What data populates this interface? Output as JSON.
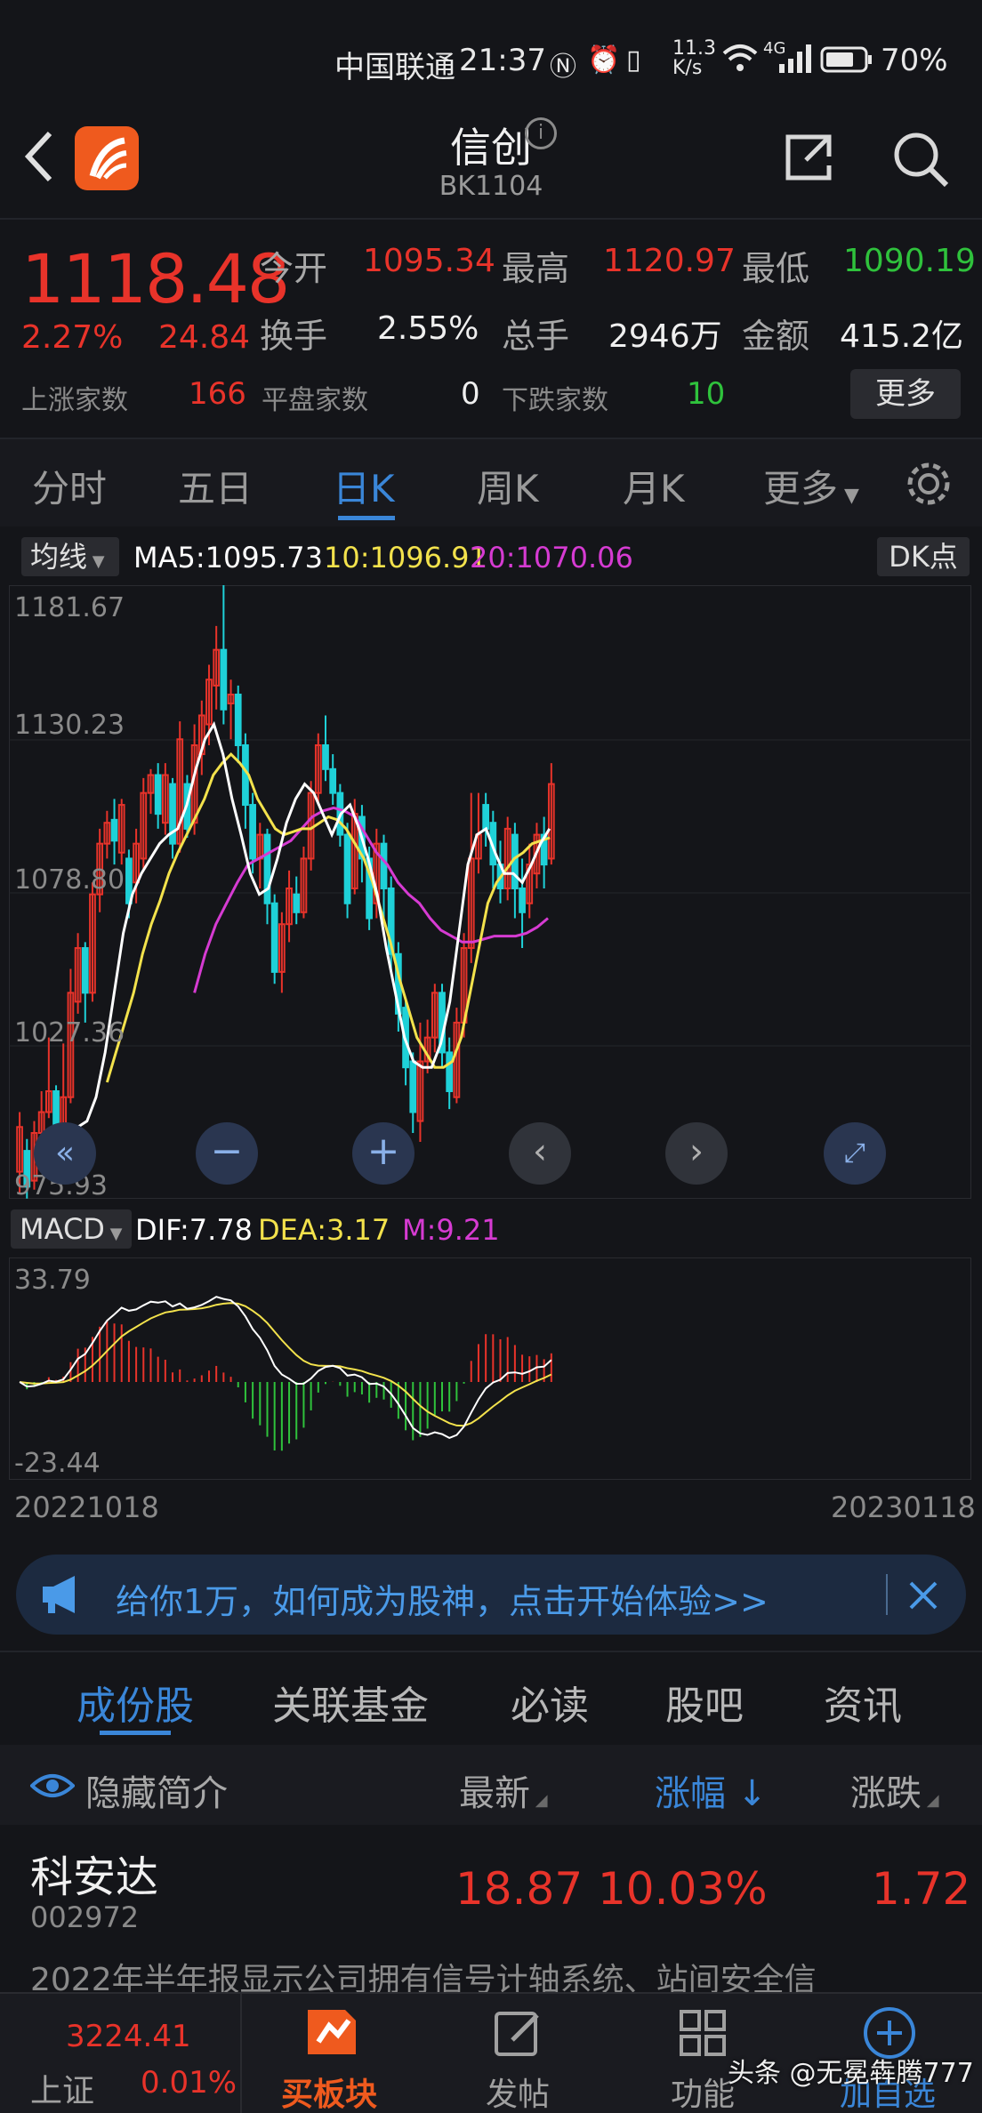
{
  "status": {
    "carrier": "中国联通",
    "time": "21:37",
    "speed_top": "11.3",
    "speed_unit": "K/s",
    "net": "4G",
    "battery": "70%"
  },
  "header": {
    "title": "信创",
    "code": "BK1104"
  },
  "quote": {
    "price": "1118.48",
    "pct": "2.27%",
    "chg": "24.84",
    "open_label": "今开",
    "open": "1095.34",
    "high_label": "最高",
    "high": "1120.97",
    "low_label": "最低",
    "low": "1090.19",
    "turnover_label": "换手",
    "turnover": "2.55%",
    "volume_label": "总手",
    "volume": "2946万",
    "amount_label": "金额",
    "amount": "415.2亿",
    "up_label": "上涨家数",
    "up": "166",
    "flat_label": "平盘家数",
    "flat": "0",
    "down_label": "下跌家数",
    "down": "10",
    "more_label": "更多"
  },
  "tabs": {
    "t1": "分时",
    "t2": "五日",
    "t3": "日K",
    "t4": "周K",
    "t5": "月K",
    "t6": "更多"
  },
  "ma": {
    "selector": "均线",
    "ma5": "MA5:1095.73",
    "ma10": "10:1096.91",
    "ma20": "20:1070.06",
    "dk": "DK点"
  },
  "price_axis": {
    "a1": "1181.67",
    "a2": "1130.23",
    "a3": "1078.80",
    "a4": "1027.36",
    "a5": "975.93"
  },
  "macd": {
    "selector": "MACD",
    "dif": "DIF:7.78",
    "dea": "DEA:3.17",
    "m": "M:9.21",
    "top": "33.79",
    "bottom": "-23.44"
  },
  "dates": {
    "start": "20221018",
    "end": "20230118"
  },
  "ad": {
    "text": "给你1万，如何成为股神，点击开始体验>>"
  },
  "subtabs": {
    "s1": "成份股",
    "s2": "关联基金",
    "s3": "必读",
    "s4": "股吧",
    "s5": "资讯"
  },
  "table": {
    "hide": "隐藏简介",
    "latest": "最新",
    "pct": "涨幅",
    "chg": "涨跌"
  },
  "row": {
    "name": "科安达",
    "code": "002972",
    "price": "18.87",
    "pct": "10.03%",
    "chg": "1.72",
    "desc": "2022年半年报显示公司拥有信号计轴系统、站间安全信"
  },
  "bottom": {
    "index_val": "3224.41",
    "index_name": "上证",
    "index_pct": "0.01%",
    "b2": "买板块",
    "b3": "发帖",
    "b4": "功能",
    "b5": "加自选"
  },
  "watermark": "头条 @无冕犇腾777",
  "colors": {
    "up": "#e8332a",
    "down": "#1fd1d8",
    "ma5": "#ffffff",
    "ma10": "#f3e24c",
    "ma20": "#d63bd2",
    "accent": "#3a86d8"
  },
  "chart_data": {
    "type": "candlestick",
    "ylim": [
      975.93,
      1181.67
    ],
    "candles": [
      {
        "o": 985,
        "c": 1000,
        "h": 1005,
        "l": 978,
        "up": true
      },
      {
        "o": 992,
        "c": 980,
        "h": 996,
        "l": 976,
        "up": false
      },
      {
        "o": 982,
        "c": 998,
        "h": 1002,
        "l": 979,
        "up": true
      },
      {
        "o": 998,
        "c": 1005,
        "h": 1012,
        "l": 994,
        "up": true
      },
      {
        "o": 1005,
        "c": 1012,
        "h": 1030,
        "l": 1003,
        "up": true
      },
      {
        "o": 1012,
        "c": 996,
        "h": 1014,
        "l": 985,
        "up": false
      },
      {
        "o": 995,
        "c": 1010,
        "h": 1028,
        "l": 992,
        "up": true
      },
      {
        "o": 1010,
        "c": 1045,
        "h": 1053,
        "l": 1008,
        "up": true
      },
      {
        "o": 1042,
        "c": 1060,
        "h": 1065,
        "l": 1038,
        "up": true
      },
      {
        "o": 1060,
        "c": 1045,
        "h": 1062,
        "l": 1035,
        "up": false
      },
      {
        "o": 1045,
        "c": 1078,
        "h": 1082,
        "l": 1042,
        "up": true
      },
      {
        "o": 1078,
        "c": 1095,
        "h": 1100,
        "l": 1072,
        "up": true
      },
      {
        "o": 1095,
        "c": 1102,
        "h": 1106,
        "l": 1090,
        "up": true
      },
      {
        "o": 1103,
        "c": 1096,
        "h": 1110,
        "l": 1088,
        "up": false
      },
      {
        "o": 1092,
        "c": 1108,
        "h": 1110,
        "l": 1088,
        "up": true
      },
      {
        "o": 1090,
        "c": 1075,
        "h": 1093,
        "l": 1070,
        "up": false
      },
      {
        "o": 1082,
        "c": 1095,
        "h": 1100,
        "l": 1075,
        "up": true
      },
      {
        "o": 1090,
        "c": 1112,
        "h": 1117,
        "l": 1086,
        "up": true
      },
      {
        "o": 1112,
        "c": 1118,
        "h": 1120,
        "l": 1105,
        "up": true
      },
      {
        "o": 1118,
        "c": 1105,
        "h": 1122,
        "l": 1100,
        "up": false
      },
      {
        "o": 1102,
        "c": 1118,
        "h": 1122,
        "l": 1098,
        "up": true
      },
      {
        "o": 1115,
        "c": 1095,
        "h": 1117,
        "l": 1090,
        "up": false
      },
      {
        "o": 1095,
        "c": 1130,
        "h": 1136,
        "l": 1092,
        "up": true
      },
      {
        "o": 1115,
        "c": 1100,
        "h": 1118,
        "l": 1097,
        "up": false
      },
      {
        "o": 1102,
        "c": 1128,
        "h": 1135,
        "l": 1098,
        "up": true
      },
      {
        "o": 1125,
        "c": 1138,
        "h": 1143,
        "l": 1118,
        "up": true
      },
      {
        "o": 1135,
        "c": 1150,
        "h": 1155,
        "l": 1128,
        "up": true
      },
      {
        "o": 1148,
        "c": 1160,
        "h": 1168,
        "l": 1140,
        "up": true
      },
      {
        "o": 1160,
        "c": 1140,
        "h": 1182,
        "l": 1135,
        "up": false
      },
      {
        "o": 1142,
        "c": 1145,
        "h": 1150,
        "l": 1130,
        "up": true
      },
      {
        "o": 1145,
        "c": 1128,
        "h": 1148,
        "l": 1122,
        "up": false
      },
      {
        "o": 1128,
        "c": 1108,
        "h": 1132,
        "l": 1100,
        "up": false
      },
      {
        "o": 1108,
        "c": 1090,
        "h": 1112,
        "l": 1085,
        "up": false
      },
      {
        "o": 1090,
        "c": 1098,
        "h": 1102,
        "l": 1080,
        "up": true
      },
      {
        "o": 1098,
        "c": 1075,
        "h": 1100,
        "l": 1068,
        "up": false
      },
      {
        "o": 1075,
        "c": 1052,
        "h": 1078,
        "l": 1048,
        "up": false
      },
      {
        "o": 1052,
        "c": 1068,
        "h": 1072,
        "l": 1045,
        "up": true
      },
      {
        "o": 1068,
        "c": 1080,
        "h": 1086,
        "l": 1062,
        "up": true
      },
      {
        "o": 1078,
        "c": 1072,
        "h": 1084,
        "l": 1068,
        "up": false
      },
      {
        "o": 1072,
        "c": 1090,
        "h": 1094,
        "l": 1070,
        "up": true
      },
      {
        "o": 1090,
        "c": 1112,
        "h": 1116,
        "l": 1086,
        "up": true
      },
      {
        "o": 1112,
        "c": 1128,
        "h": 1132,
        "l": 1108,
        "up": true
      },
      {
        "o": 1128,
        "c": 1120,
        "h": 1138,
        "l": 1116,
        "up": false
      },
      {
        "o": 1120,
        "c": 1112,
        "h": 1125,
        "l": 1108,
        "up": false
      },
      {
        "o": 1112,
        "c": 1098,
        "h": 1115,
        "l": 1094,
        "up": false
      },
      {
        "o": 1098,
        "c": 1075,
        "h": 1102,
        "l": 1070,
        "up": false
      },
      {
        "o": 1080,
        "c": 1105,
        "h": 1110,
        "l": 1078,
        "up": true
      },
      {
        "o": 1104,
        "c": 1090,
        "h": 1108,
        "l": 1082,
        "up": false
      },
      {
        "o": 1090,
        "c": 1070,
        "h": 1094,
        "l": 1066,
        "up": false
      },
      {
        "o": 1075,
        "c": 1095,
        "h": 1100,
        "l": 1070,
        "up": true
      },
      {
        "o": 1095,
        "c": 1080,
        "h": 1098,
        "l": 1070,
        "up": false
      },
      {
        "o": 1080,
        "c": 1058,
        "h": 1084,
        "l": 1052,
        "up": false
      },
      {
        "o": 1058,
        "c": 1038,
        "h": 1062,
        "l": 1032,
        "up": false
      },
      {
        "o": 1040,
        "c": 1020,
        "h": 1043,
        "l": 1014,
        "up": false
      },
      {
        "o": 1022,
        "c": 1005,
        "h": 1025,
        "l": 998,
        "up": false
      },
      {
        "o": 1002,
        "c": 1022,
        "h": 1035,
        "l": 995,
        "up": true
      },
      {
        "o": 1022,
        "c": 1030,
        "h": 1036,
        "l": 1018,
        "up": true
      },
      {
        "o": 1030,
        "c": 1045,
        "h": 1048,
        "l": 1025,
        "up": true
      },
      {
        "o": 1045,
        "c": 1025,
        "h": 1048,
        "l": 1020,
        "up": false
      },
      {
        "o": 1025,
        "c": 1012,
        "h": 1030,
        "l": 1006,
        "up": false
      },
      {
        "o": 1010,
        "c": 1035,
        "h": 1040,
        "l": 1008,
        "up": true
      },
      {
        "o": 1035,
        "c": 1060,
        "h": 1065,
        "l": 1030,
        "up": true
      },
      {
        "o": 1060,
        "c": 1090,
        "h": 1112,
        "l": 1055,
        "up": true
      },
      {
        "o": 1090,
        "c": 1098,
        "h": 1112,
        "l": 1085,
        "up": true
      },
      {
        "o": 1108,
        "c": 1100,
        "h": 1112,
        "l": 1094,
        "up": false
      },
      {
        "o": 1102,
        "c": 1088,
        "h": 1106,
        "l": 1080,
        "up": false
      },
      {
        "o": 1088,
        "c": 1080,
        "h": 1096,
        "l": 1075,
        "up": false
      },
      {
        "o": 1080,
        "c": 1100,
        "h": 1104,
        "l": 1076,
        "up": true
      },
      {
        "o": 1098,
        "c": 1080,
        "h": 1102,
        "l": 1070,
        "up": false
      },
      {
        "o": 1080,
        "c": 1072,
        "h": 1090,
        "l": 1060,
        "up": false
      },
      {
        "o": 1075,
        "c": 1088,
        "h": 1095,
        "l": 1070,
        "up": true
      },
      {
        "o": 1085,
        "c": 1098,
        "h": 1102,
        "l": 1080,
        "up": true
      },
      {
        "o": 1098,
        "c": 1088,
        "h": 1104,
        "l": 1080,
        "up": false
      },
      {
        "o": 1090,
        "c": 1115,
        "h": 1122,
        "l": 1088,
        "up": true
      }
    ],
    "ma5": [
      1000,
      1002,
      1010,
      1025,
      1045,
      1065,
      1078,
      1085,
      1090,
      1095,
      1098,
      1100,
      1108,
      1120,
      1130,
      1135,
      1125,
      1110,
      1098,
      1085,
      1078,
      1080,
      1090,
      1102,
      1110,
      1115,
      1112,
      1105,
      1098,
      1105,
      1108,
      1100,
      1090,
      1078,
      1060,
      1045,
      1030,
      1022,
      1020,
      1020,
      1028,
      1042,
      1065,
      1088,
      1098,
      1100,
      1092,
      1085,
      1085,
      1082,
      1088,
      1095,
      1100
    ],
    "ma10": [
      1015,
      1025,
      1035,
      1045,
      1058,
      1068,
      1076,
      1085,
      1092,
      1098,
      1104,
      1110,
      1118,
      1122,
      1125,
      1122,
      1118,
      1110,
      1105,
      1100,
      1098,
      1099,
      1100,
      1100,
      1102,
      1104,
      1103,
      1100,
      1095,
      1090,
      1082,
      1072,
      1062,
      1050,
      1040,
      1030,
      1025,
      1020,
      1020,
      1022,
      1030,
      1045,
      1060,
      1075,
      1082,
      1086,
      1090,
      1092,
      1095,
      1096,
      1097
    ],
    "ma20": [
      1045,
      1058,
      1068,
      1075,
      1082,
      1088,
      1090,
      1092,
      1094,
      1096,
      1100,
      1104,
      1106,
      1107,
      1106,
      1104,
      1098,
      1092,
      1088,
      1082,
      1078,
      1075,
      1070,
      1066,
      1064,
      1062,
      1062,
      1063,
      1064,
      1064,
      1064,
      1065,
      1067,
      1070
    ]
  }
}
